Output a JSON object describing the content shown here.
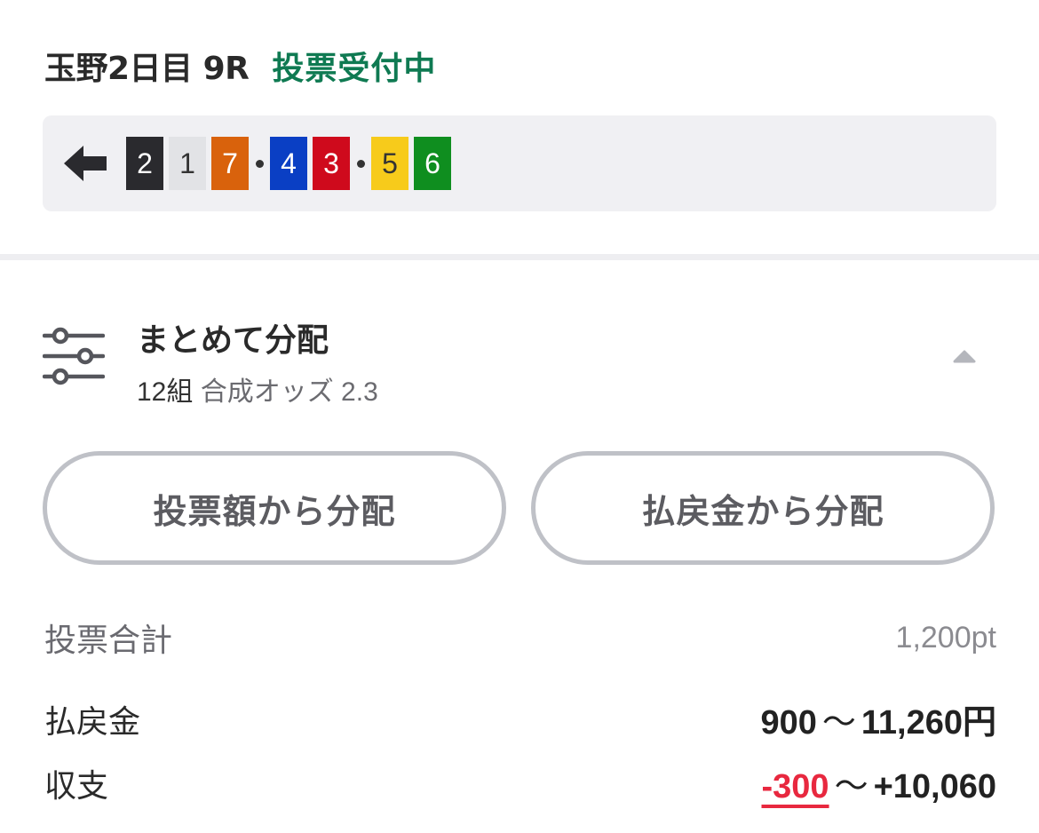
{
  "race": {
    "title": "玉野2日目 9R",
    "status": "投票受付中",
    "status_color": "#0f7a52"
  },
  "combination": {
    "icon": "left-arrow-icon",
    "groups": [
      [
        {
          "num": "2",
          "bg": "#2a2a2e",
          "fg": "#ffffff"
        },
        {
          "num": "1",
          "bg": "#e2e3e6",
          "fg": "#333333"
        },
        {
          "num": "7",
          "bg": "#d9620c",
          "fg": "#ffffff"
        }
      ],
      [
        {
          "num": "4",
          "bg": "#0a3fc4",
          "fg": "#ffffff"
        },
        {
          "num": "3",
          "bg": "#cf0a1c",
          "fg": "#ffffff"
        }
      ],
      [
        {
          "num": "5",
          "bg": "#f7cb1b",
          "fg": "#333333"
        },
        {
          "num": "6",
          "bg": "#0f8e1f",
          "fg": "#ffffff"
        }
      ]
    ]
  },
  "distribution": {
    "icon": "sliders-icon",
    "title": "まとめて分配",
    "count": "12組",
    "odds": "合成オッズ 2.3",
    "collapse_icon": "chevron-up-icon"
  },
  "buttons": {
    "by_bet": "投票額から分配",
    "by_payout": "払戻金から分配"
  },
  "summary": {
    "total_label": "投票合計",
    "total_value": "1,200pt",
    "payout_label": "払戻金",
    "payout_min": "900",
    "payout_max": "11,260円",
    "balance_label": "収支",
    "balance_min": "-300",
    "balance_max": "+10,060",
    "tilde": "～",
    "negative_color": "#e8283f"
  }
}
